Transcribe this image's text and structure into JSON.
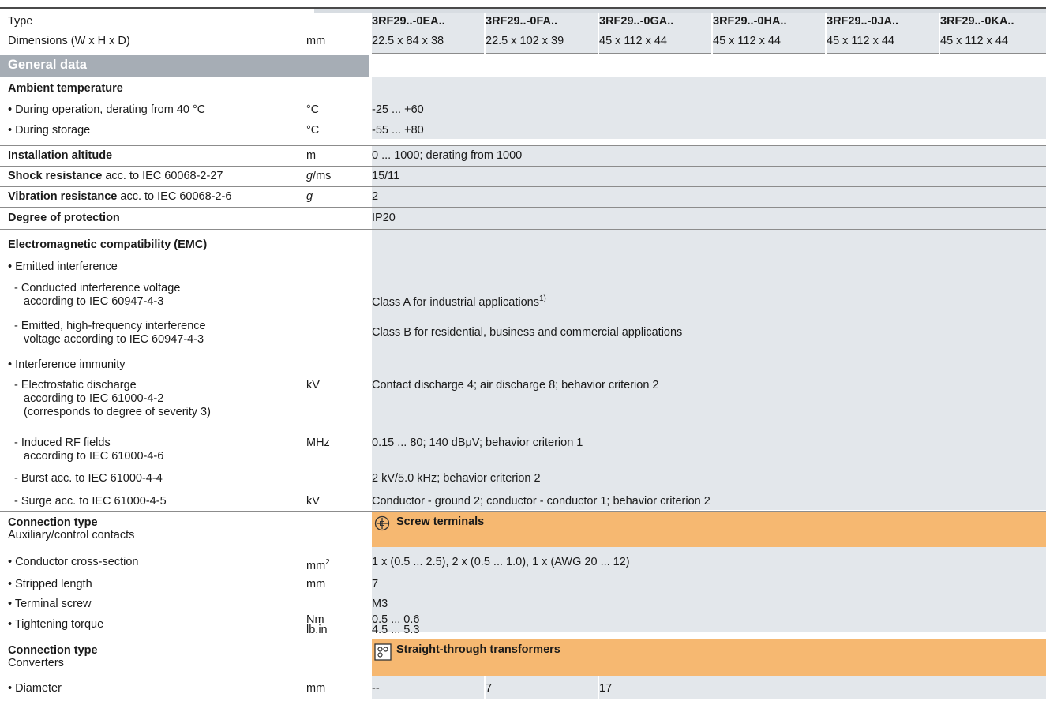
{
  "header": {
    "type_label": "Type",
    "dim_label": "Dimensions (W x H x D)",
    "dim_unit": "mm",
    "types": [
      "3RF29..-0EA..",
      "3RF29..-0FA..",
      "3RF29..-0GA..",
      "3RF29..-0HA..",
      "3RF29..-0JA..",
      "3RF29..-0KA.."
    ],
    "dims": [
      "22.5 x 84 x 38",
      "22.5 x 102 x 39",
      "45 x 112 x 44",
      "45 x 112 x 44",
      "45 x 112 x 44",
      "45 x 112 x 44"
    ]
  },
  "section_title": "General data",
  "ambient": {
    "title": "Ambient temperature",
    "op_label": "• During operation, derating from 40 °C",
    "op_unit": "°C",
    "op_value": "-25 ... +60",
    "st_label": "• During storage",
    "st_unit": "°C",
    "st_value": "-55 ... +80"
  },
  "altitude": {
    "label": "Installation altitude",
    "unit": "m",
    "value": "0 ... 1000; derating from 1000"
  },
  "shock": {
    "label_bold": "Shock resistance",
    "label_rest": " acc. to IEC 60068-2-27",
    "unit_g": "g",
    "unit_rest": "/ms",
    "value": "15/11"
  },
  "vibration": {
    "label_bold": "Vibration resistance",
    "label_rest": " acc. to IEC 60068-2-6",
    "unit": "g",
    "value": "2"
  },
  "protection": {
    "label": "Degree of protection",
    "value": "IP20"
  },
  "emc": {
    "title": "Electromagnetic compatibility (EMC)",
    "emitted": "• Emitted interference",
    "conducted_l1": "- Conducted interference voltage",
    "conducted_l2": "according to IEC 60947-4-3",
    "conducted_value": "Class A for industrial applications",
    "conducted_sup": "1)",
    "hf_l1": "- Emitted, high-frequency interference",
    "hf_l2": "voltage according to IEC 60947-4-3",
    "hf_value": "Class B for residential, business and commercial applications",
    "immunity": "• Interference immunity",
    "esd_l1": "- Electrostatic discharge",
    "esd_l2": "according to IEC 61000-4-2",
    "esd_l3": "(corresponds to degree of severity 3)",
    "esd_unit": "kV",
    "esd_value": "Contact discharge 4; air discharge 8; behavior criterion 2",
    "rf_l1": "- Induced RF fields",
    "rf_l2": "according to IEC 61000-4-6",
    "rf_unit": "MHz",
    "rf_value": "0.15 ... 80; 140 dBμV; behavior criterion 1",
    "burst_label": "- Burst acc. to IEC 61000-4-4",
    "burst_value": "2 kV/5.0 kHz; behavior criterion 2",
    "surge_label": "- Surge acc. to IEC 61000-4-5",
    "surge_unit": "kV",
    "surge_value": "Conductor - ground 2; conductor - conductor 1; behavior criterion 2"
  },
  "conn1": {
    "title": "Connection type",
    "subtitle": "Auxiliary/control contacts",
    "banner": "Screw terminals",
    "icon": "screw-terminal-icon",
    "cs_label": "• Conductor cross-section",
    "cs_unit": "mm",
    "cs_unit_sup": "2",
    "cs_value": "1 x (0.5 ... 2.5), 2 x (0.5 ... 1.0), 1 x (AWG 20 ... 12)",
    "strip_label": "• Stripped length",
    "strip_unit": "mm",
    "strip_value": "7",
    "screw_label": "• Terminal screw",
    "screw_value": "M3",
    "torque_label": "• Tightening torque",
    "torque_unit1": "Nm",
    "torque_unit2": "lb.in",
    "torque_value1": "0.5 ... 0.6",
    "torque_value2": "4.5 ... 5.3"
  },
  "conn2": {
    "title": "Connection type",
    "subtitle": "Converters",
    "banner": "Straight-through transformers",
    "icon": "straight-through-transformer-icon",
    "dia_label": "• Diameter",
    "dia_unit": "mm",
    "dia_values": [
      "--",
      "7",
      "17"
    ]
  },
  "colors": {
    "value_bg": "#e3e7eb",
    "section_bg": "#a6adb5",
    "banner_bg": "#f6b871"
  }
}
